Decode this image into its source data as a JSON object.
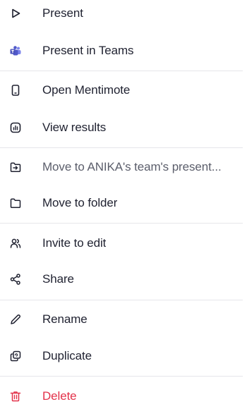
{
  "menu": {
    "present": "Present",
    "present_in_teams": "Present in Teams",
    "open_mentimote": "Open Mentimote",
    "view_results": "View results",
    "move_to_team": "Move to ANIKA's team's present...",
    "move_to_folder": "Move to folder",
    "invite_to_edit": "Invite to edit",
    "share": "Share",
    "rename": "Rename",
    "duplicate": "Duplicate",
    "delete": "Delete"
  },
  "icons": {
    "present": "play-icon",
    "present_in_teams": "teams-icon",
    "open_mentimote": "phone-icon",
    "view_results": "results-icon",
    "move_to_team": "move-to-icon",
    "move_to_folder": "folder-icon",
    "invite_to_edit": "people-icon",
    "share": "share-icon",
    "rename": "pencil-icon",
    "duplicate": "duplicate-icon",
    "delete": "trash-icon"
  },
  "colors": {
    "text": "#1f2130",
    "muted_text": "#5b5e6b",
    "danger": "#e3324a",
    "teams": "#5059c9",
    "divider": "#e6e6ea"
  }
}
